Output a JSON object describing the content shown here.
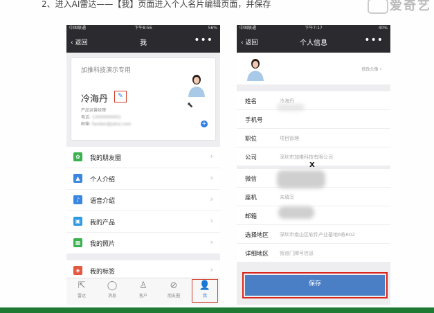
{
  "slide": {
    "instruction": "2、进入AI雷达——【我】页面进入个人名片编辑页面，并保存",
    "watermark": "爱奇艺"
  },
  "phone1": {
    "status": {
      "carrier": "中国联通",
      "time": "下午8:56",
      "battery": "56%"
    },
    "nav": {
      "back": "返回",
      "title": "我",
      "more": "•••"
    },
    "card": {
      "company": "加推科技演示专用",
      "name": "冷海丹",
      "edit_icon": "pencil-icon",
      "position": "产品运营经理",
      "phone_label": "电话:",
      "phone_value": "13000000001",
      "email_label": "邮箱:",
      "email_value": "fandan@jiatui.com",
      "add_icon": "plus-circle-icon"
    },
    "menu": [
      {
        "label": "我的朋友圈",
        "icon": "moments-icon",
        "color": "#3bb24f"
      },
      {
        "label": "个人介绍",
        "icon": "person-icon",
        "color": "#3a86e0"
      },
      {
        "label": "语音介绍",
        "icon": "microphone-icon",
        "color": "#3a86e0"
      },
      {
        "label": "我的产品",
        "icon": "box-icon",
        "color": "#2d9ae6"
      },
      {
        "label": "我的照片",
        "icon": "photo-icon",
        "color": "#3bb24f"
      }
    ],
    "menu2": [
      {
        "label": "我的标签",
        "icon": "tag-icon",
        "color": "#e5573f"
      }
    ],
    "tabs": [
      {
        "label": "雷达",
        "icon": "radar-icon",
        "glyph": "⇱"
      },
      {
        "label": "消息",
        "icon": "message-icon",
        "glyph": "◯"
      },
      {
        "label": "客户",
        "icon": "customers-icon",
        "glyph": "♙"
      },
      {
        "label": "朋友圈",
        "icon": "compass-icon",
        "glyph": "⊘"
      },
      {
        "label": "我",
        "icon": "me-icon",
        "glyph": "👤"
      }
    ]
  },
  "phone2": {
    "status": {
      "carrier": "中国联通",
      "time": "下午7:17",
      "battery": "40%"
    },
    "nav": {
      "back": "返回",
      "title": "个人信息",
      "more": "•••"
    },
    "change_photo": "修改头像",
    "fields_a": [
      {
        "label": "姓名",
        "value": "冷海丹"
      },
      {
        "label": "手机号",
        "value": ""
      },
      {
        "label": "职位",
        "value": "项目管理"
      },
      {
        "label": "公司",
        "value": "深圳市加推科技有限公司"
      }
    ],
    "fields_b": [
      {
        "label": "微信",
        "value": ""
      },
      {
        "label": "座机",
        "value": "未填写"
      },
      {
        "label": "邮箱",
        "value": ""
      },
      {
        "label": "选择地区",
        "value": "深圳市南山区软件产业基地6栋602"
      },
      {
        "label": "详细地区",
        "value": "街道门牌号信息"
      }
    ],
    "x_mark": "X",
    "save": "保存"
  },
  "colors": {
    "nav_bg": "#2b2b2f",
    "highlight": "#d8261c",
    "save": "#4a7fc6",
    "accent": "#2a7be3"
  }
}
